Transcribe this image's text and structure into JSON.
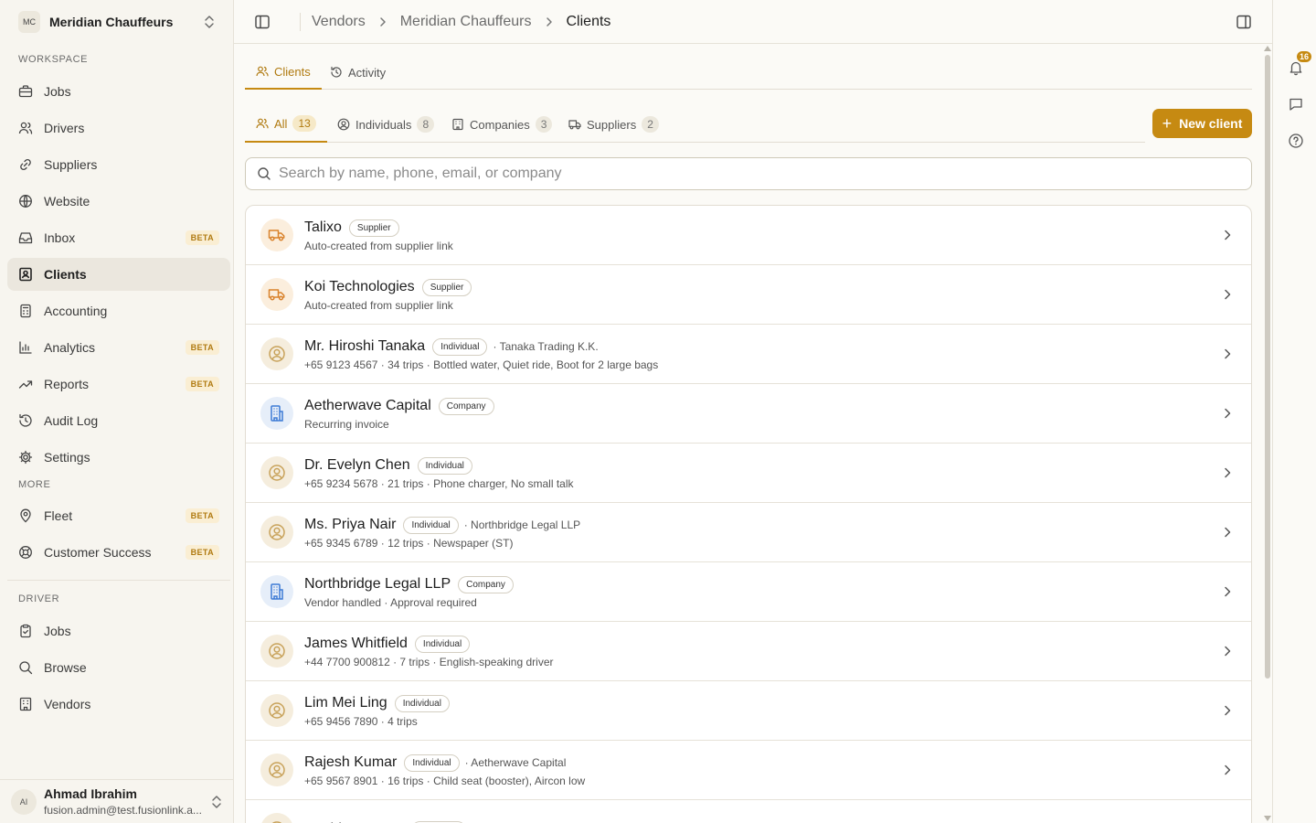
{
  "workspace": {
    "initials": "MC",
    "name": "Meridian Chauffeurs"
  },
  "sidebar": {
    "sections": [
      {
        "label": "WORKSPACE"
      },
      {
        "label": "MORE"
      },
      {
        "label": "DRIVER"
      }
    ],
    "workspace_items": [
      {
        "label": "Jobs",
        "icon": "briefcase-icon"
      },
      {
        "label": "Drivers",
        "icon": "users-icon"
      },
      {
        "label": "Suppliers",
        "icon": "link-icon"
      },
      {
        "label": "Website",
        "icon": "globe-icon"
      },
      {
        "label": "Inbox",
        "icon": "inbox-icon",
        "badge": "BETA"
      },
      {
        "label": "Clients",
        "icon": "contact-icon",
        "active": true
      },
      {
        "label": "Accounting",
        "icon": "calculator-icon"
      },
      {
        "label": "Analytics",
        "icon": "bar-chart-icon",
        "badge": "BETA"
      },
      {
        "label": "Reports",
        "icon": "trending-up-icon",
        "badge": "BETA"
      },
      {
        "label": "Audit Log",
        "icon": "history-icon"
      },
      {
        "label": "Settings",
        "icon": "gear-icon"
      }
    ],
    "more_items": [
      {
        "label": "Fleet",
        "icon": "map-pin-icon",
        "badge": "BETA"
      },
      {
        "label": "Customer Success",
        "icon": "lifebuoy-icon",
        "badge": "BETA"
      }
    ],
    "driver_items": [
      {
        "label": "Jobs",
        "icon": "clipboard-check-icon"
      },
      {
        "label": "Browse",
        "icon": "search-icon"
      },
      {
        "label": "Vendors",
        "icon": "building-icon"
      }
    ]
  },
  "user": {
    "initials": "AI",
    "name": "Ahmad Ibrahim",
    "email": "fusion.admin@test.fusionlink.a..."
  },
  "breadcrumb": [
    "Vendors",
    "Meridian Chauffeurs",
    "Clients"
  ],
  "notifications": {
    "count": "16"
  },
  "tabs": [
    {
      "label": "Clients",
      "active": true
    },
    {
      "label": "Activity"
    }
  ],
  "filters": [
    {
      "label": "All",
      "count": "13",
      "active": true
    },
    {
      "label": "Individuals",
      "count": "8"
    },
    {
      "label": "Companies",
      "count": "3"
    },
    {
      "label": "Suppliers",
      "count": "2"
    }
  ],
  "new_client_label": "New client",
  "search": {
    "placeholder": "Search by name, phone, email, or company",
    "value": ""
  },
  "clients": [
    {
      "name": "Talixo",
      "type": "Supplier",
      "kind": "supplier",
      "affiliation": "",
      "details": "Auto-created from supplier link"
    },
    {
      "name": "Koi Technologies",
      "type": "Supplier",
      "kind": "supplier",
      "affiliation": "",
      "details": "Auto-created from supplier link"
    },
    {
      "name": "Mr. Hiroshi Tanaka",
      "type": "Individual",
      "kind": "individual",
      "affiliation": "· Tanaka Trading K.K.",
      "details": "+65 9123 4567  ·  34 trips  ·  Bottled water, Quiet ride, Boot for 2 large bags"
    },
    {
      "name": "Aetherwave Capital",
      "type": "Company",
      "kind": "company",
      "affiliation": "",
      "details": "Recurring invoice"
    },
    {
      "name": "Dr. Evelyn Chen",
      "type": "Individual",
      "kind": "individual",
      "affiliation": "",
      "details": "+65 9234 5678  ·  21 trips  ·  Phone charger, No small talk"
    },
    {
      "name": "Ms. Priya Nair",
      "type": "Individual",
      "kind": "individual",
      "affiliation": "· Northbridge Legal LLP",
      "details": "+65 9345 6789  ·  12 trips  ·  Newspaper (ST)"
    },
    {
      "name": "Northbridge Legal LLP",
      "type": "Company",
      "kind": "company",
      "affiliation": "",
      "details": "Vendor handled  ·  Approval required"
    },
    {
      "name": "James Whitfield",
      "type": "Individual",
      "kind": "individual",
      "affiliation": "",
      "details": "+44 7700 900812  ·  7 trips  ·  English-speaking driver"
    },
    {
      "name": "Lim Mei Ling",
      "type": "Individual",
      "kind": "individual",
      "affiliation": "",
      "details": "+65 9456 7890  ·  4 trips"
    },
    {
      "name": "Rajesh Kumar",
      "type": "Individual",
      "kind": "individual",
      "affiliation": "· Aetherwave Capital",
      "details": "+65 9567 8901  ·  16 trips  ·  Child seat (booster), Aircon low"
    },
    {
      "name": "Sophia Laurent",
      "type": "Individual",
      "kind": "individual",
      "affiliation": "",
      "details": ""
    }
  ],
  "colors": {
    "accent": "#c68a12",
    "accent_text": "#b07a10",
    "beta": "#b07a10"
  }
}
